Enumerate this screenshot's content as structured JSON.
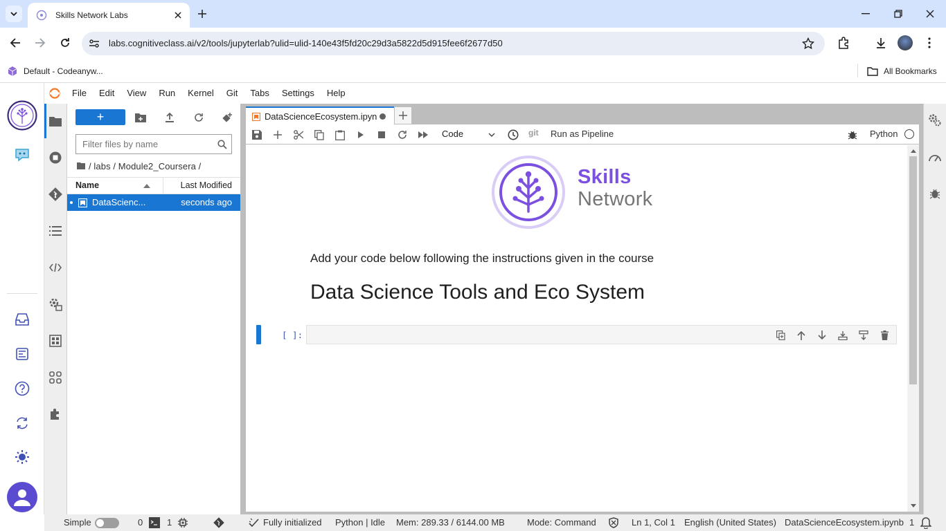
{
  "browser": {
    "tab_title": "Skills Network Labs",
    "url": "labs.cognitiveclass.ai/v2/tools/jupyterlab?ulid=ulid-140e43f5fd20c29d3a5822d5d915fee6f2677d50",
    "bookmark_label": "Default - Codeanyw...",
    "all_bookmarks": "All Bookmarks"
  },
  "menus": [
    "File",
    "Edit",
    "View",
    "Run",
    "Kernel",
    "Git",
    "Tabs",
    "Settings",
    "Help"
  ],
  "filebrowser": {
    "new_label": "+",
    "filter_placeholder": "Filter files by name",
    "breadcrumb": "/ labs / Module2_Coursera /",
    "col_name": "Name",
    "col_modified": "Last Modified",
    "file_name": "DataScienc...",
    "file_modified": "seconds ago"
  },
  "notebook": {
    "tab_label": "DataScienceEcosystem.ipyn",
    "cell_type": "Code",
    "git_label": "git",
    "pipeline_label": "Run as Pipeline",
    "kernel_name": "Python",
    "logo_line1": "Skills",
    "logo_line2": "Network",
    "instruction_text": "Add your code below following the instructions given in the course",
    "heading": "Data Science Tools and Eco System",
    "prompt": "[ ]:"
  },
  "status": {
    "mode_label": "Simple",
    "terminals": "0",
    "kernels": "1",
    "init_text": "Fully initialized",
    "kernel_status": "Python | Idle",
    "memory": "Mem: 289.33 / 6144.00 MB",
    "mode": "Mode: Command",
    "position": "Ln 1, Col 1",
    "language": "English (United States)",
    "filename": "DataScienceEcosystem.ipynb",
    "notifications": "1"
  },
  "colors": {
    "accent": "#1976d2",
    "brand_purple": "#7b4fe0",
    "brand_gray": "#757575",
    "unsaved_dot": "#616161"
  }
}
